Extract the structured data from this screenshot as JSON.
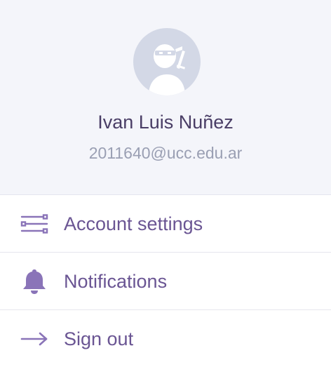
{
  "user": {
    "name": "Ivan Luis Nuñez",
    "email": "2011640@ucc.edu.ar",
    "avatar_icon": "ninja-avatar-icon"
  },
  "menu": {
    "items": [
      {
        "label": "Account settings",
        "icon": "sliders-icon"
      },
      {
        "label": "Notifications",
        "icon": "bell-icon"
      },
      {
        "label": "Sign out",
        "icon": "arrow-right-icon"
      }
    ]
  },
  "colors": {
    "header_bg": "#f4f5fa",
    "avatar_bg": "#d3d8e6",
    "name": "#4a3e66",
    "email": "#9a9fb3",
    "menu_text": "#6a5593",
    "icon": "#8a74b8",
    "divider": "#e6e6ee"
  }
}
